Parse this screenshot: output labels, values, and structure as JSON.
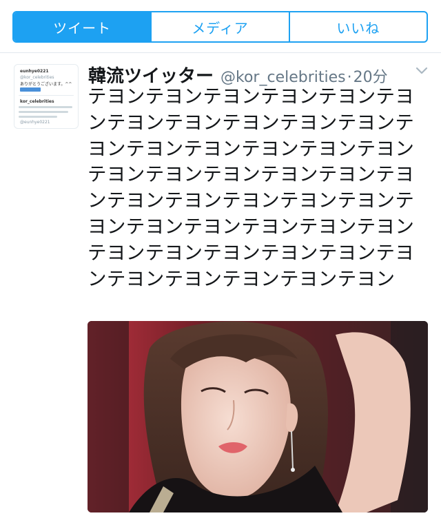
{
  "tabs": [
    {
      "label": "ツイート",
      "active": true
    },
    {
      "label": "メディア",
      "active": false
    },
    {
      "label": "いいね",
      "active": false
    }
  ],
  "tweet": {
    "display_name": "韓流ツイッター",
    "handle": "@kor_celebrities",
    "separator": "·",
    "time": "20分",
    "text": "テヨンテヨンテヨンテヨンテヨンテヨンテヨンテヨンテヨンテヨンテヨンテヨンテヨンテヨンテヨンテヨンテヨンテヨンテヨンテヨンテヨンテヨンテヨンテヨンテヨンテヨンテヨンテヨンテヨンテヨンテヨンテヨンテヨンテヨンテヨンテヨンテヨンテヨンテヨンテヨンテヨンテヨンテヨンテヨンテヨン"
  },
  "thumbnail": {
    "user1": "eunhye0221",
    "mention": "@kor_celebrities",
    "reply": "ありがとうございます。^^",
    "user2": "kor_celebrities",
    "user3": "@eunhye0221"
  },
  "colors": {
    "accent": "#1da1f2",
    "text": "#14171a",
    "secondary": "#657786"
  },
  "icons": {
    "caret": "chevron-down-icon"
  }
}
